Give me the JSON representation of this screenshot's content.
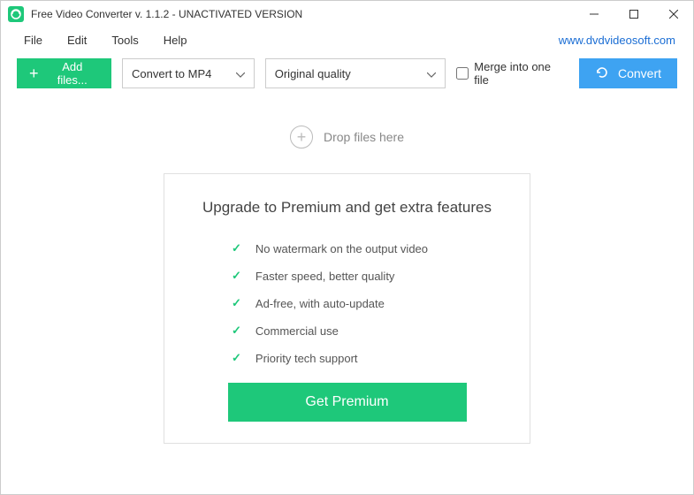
{
  "titlebar": {
    "title": "Free Video Converter v. 1.1.2 - UNACTIVATED VERSION"
  },
  "menubar": {
    "items": [
      "File",
      "Edit",
      "Tools",
      "Help"
    ],
    "website": "www.dvdvideosoft.com"
  },
  "toolbar": {
    "add_files": "Add files...",
    "format_selected": "Convert to MP4",
    "quality_selected": "Original quality",
    "merge_label": "Merge into one file",
    "convert": "Convert"
  },
  "dropzone": {
    "label": "Drop files here"
  },
  "premium": {
    "title": "Upgrade to Premium and get extra features",
    "features": [
      "No watermark on the output video",
      "Faster speed, better quality",
      "Ad-free, with auto-update",
      "Commercial use",
      "Priority tech support"
    ],
    "cta": "Get Premium"
  }
}
